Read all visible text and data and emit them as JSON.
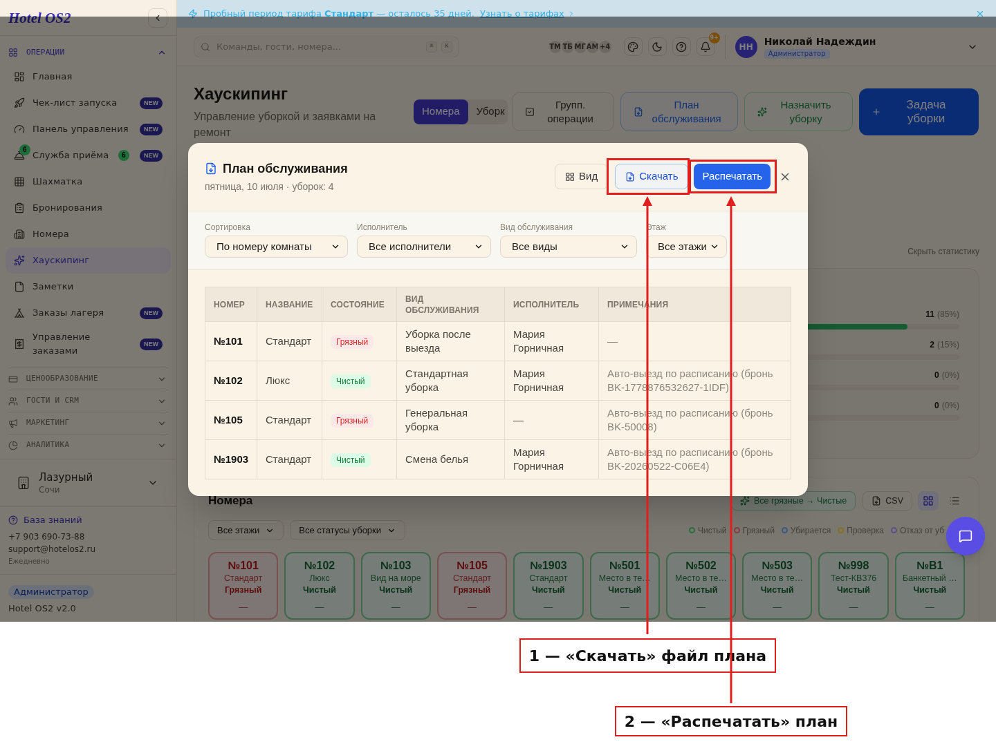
{
  "sidebar": {
    "logo": "Hotel OS2",
    "sections": [
      {
        "title": "ОПЕРАЦИИ",
        "expanded": true,
        "items": [
          {
            "label": "Главная",
            "selected": false
          },
          {
            "label": "Чек-лист запуска",
            "selected": false,
            "badge": "NEW"
          },
          {
            "label": "Панель управления",
            "selected": false,
            "badge": "NEW"
          },
          {
            "label": "Служба приёма",
            "selected": false,
            "icon_badge": "6",
            "count": "6",
            "badge": "NEW"
          },
          {
            "label": "Шахматка",
            "selected": false
          },
          {
            "label": "Бронирования",
            "selected": false
          },
          {
            "label": "Номера",
            "selected": false
          },
          {
            "label": "Хаускипинг",
            "selected": true
          },
          {
            "label": "Заметки",
            "selected": false
          },
          {
            "label": "Заказы лагеря",
            "selected": false,
            "badge": "NEW"
          },
          {
            "label": "Управление заказами",
            "selected": false,
            "badge": "NEW"
          }
        ]
      },
      {
        "title": "ЦЕНООБРАЗОВАНИЕ",
        "expanded": false
      },
      {
        "title": "ГОСТИ И CRM",
        "expanded": false
      },
      {
        "title": "МАРКЕТИНГ",
        "expanded": false
      },
      {
        "title": "АНАЛИТИКА",
        "expanded": false
      }
    ],
    "hotel": {
      "name": "Лазурный",
      "city": "Сочи"
    },
    "help_link": "База знаний",
    "phone": "+7 903 690-73-88",
    "email": "support@hotelos2.ru",
    "hours": "Ежедневно",
    "role": "Администратор",
    "version": "Hotel OS2 v2.0"
  },
  "banner": {
    "text": "Пробный период тарифа **Стандарт** — осталось 35 дней.",
    "link": "Узнать о тарифах"
  },
  "topbar": {
    "search": {
      "placeholder": "Команды, гости, номера...",
      "keys": [
        "⌘",
        "K"
      ]
    },
    "presence": [
      "ТМ",
      "ТБ",
      "МГ",
      "АМ"
    ],
    "presence_more": "+4",
    "notifications": "9+",
    "user": {
      "initials": "НН",
      "name": "Николай Надеждин",
      "role": "Администратор"
    }
  },
  "header": {
    "title": "Хаускипинг",
    "subtitle": "Управление уборкой и заявками на ремонт",
    "view_tabs": [
      {
        "label": "Номера",
        "selected": true
      },
      {
        "label": "Уборк",
        "selected": false
      }
    ],
    "actions": [
      {
        "label": "Групп. операции",
        "kind": "outline"
      },
      {
        "label": "План обслуживания",
        "kind": "blue"
      },
      {
        "label": "Назначить уборку",
        "kind": "green"
      },
      {
        "label": "Задача уборки",
        "kind": "primary"
      }
    ]
  },
  "stats": {
    "toggle": "Скрыть статистику",
    "rows": [
      {
        "count": "11",
        "percent": "(85%)",
        "level": 0.85
      },
      {
        "count": "2",
        "percent": "(15%)"
      },
      {
        "count": "0",
        "percent": "(0%)"
      },
      {
        "count": "0",
        "percent": "(0%)"
      }
    ]
  },
  "rooms": {
    "title": "Номера",
    "bulk_action": "Все грязные → Чистые",
    "export": "CSV",
    "views": [
      {
        "kind": "grid",
        "selected": true
      },
      {
        "kind": "list",
        "selected": false
      }
    ],
    "filters": [
      "Все этажи",
      "Все статусы уборки"
    ],
    "legend": [
      {
        "label": "Чистый",
        "color": "#2a7046"
      },
      {
        "label": "Грязный",
        "color": "#8a3d3d"
      },
      {
        "label": "Убирается",
        "color": "#3a5a86"
      },
      {
        "label": "Проверка",
        "color": "#86701a"
      },
      {
        "label": "Отказ от уб",
        "color": "#5c4e8c"
      }
    ],
    "cards": [
      {
        "number": "№101",
        "type": "Стандарт",
        "status": "Грязный",
        "kind": "dirty",
        "note": "—"
      },
      {
        "number": "№102",
        "type": "Люкс",
        "status": "Чистый",
        "kind": "clean",
        "note": "—"
      },
      {
        "number": "№103",
        "type": "Вид на море",
        "status": "Чистый",
        "kind": "clean",
        "note": "—"
      },
      {
        "number": "№105",
        "type": "Стандарт",
        "status": "Грязный",
        "kind": "dirty",
        "note": "—"
      },
      {
        "number": "№1903",
        "type": "Стандарт",
        "status": "Чистый",
        "kind": "clean",
        "note": "—"
      },
      {
        "number": "№501",
        "type": "Место в те…",
        "status": "Чистый",
        "kind": "clean",
        "note": "—"
      },
      {
        "number": "№502",
        "type": "Место в те…",
        "status": "Чистый",
        "kind": "clean",
        "note": "—"
      },
      {
        "number": "№503",
        "type": "Место в те…",
        "status": "Чистый",
        "kind": "clean",
        "note": "—"
      },
      {
        "number": "№998",
        "type": "Тест-КВ376",
        "status": "Чистый",
        "kind": "clean",
        "note": "—"
      },
      {
        "number": "№В1",
        "type": "Банкетный …",
        "status": "Чистый",
        "kind": "clean",
        "note": "—"
      }
    ]
  },
  "plan_modal": {
    "title": "План обслуживания",
    "subtitle": "пятница, 10 июля · уборок: 4",
    "actions": [
      {
        "label": "Вид",
        "kind": "view"
      },
      {
        "label": "Скачать",
        "kind": "download"
      },
      {
        "label": "Распечатать",
        "kind": "print"
      }
    ],
    "filters": [
      {
        "label": "Сортировка",
        "value": "По номеру комнаты"
      },
      {
        "label": "Исполнитель",
        "value": "Все исполнители"
      },
      {
        "label": "Вид обслуживания",
        "value": "Все виды"
      },
      {
        "label": "Этаж",
        "value": "Все этажи"
      }
    ],
    "table": {
      "columns": [
        "НОМЕР",
        "НАЗВАНИЕ",
        "СОСТОЯНИЕ",
        "ВИД ОБСЛУЖИВАНИЯ",
        "ИСПОЛНИТЕЛЬ",
        "ПРИМЕЧАНИЯ"
      ],
      "rows": [
        {
          "number": "№101",
          "name": "Стандарт",
          "status": {
            "label": "Грязный",
            "kind": "dirty"
          },
          "service": "Уборка после выезда",
          "assignee": "Мария Горничная",
          "notes": "—"
        },
        {
          "number": "№102",
          "name": "Люкс",
          "status": {
            "label": "Чистый",
            "kind": "clean"
          },
          "service": "Стандартная уборка",
          "assignee": "Мария Горничная",
          "notes": "Авто-выезд по расписанию (бронь BK-1778876532627-1IDF)"
        },
        {
          "number": "№105",
          "name": "Стандарт",
          "status": {
            "label": "Грязный",
            "kind": "dirty"
          },
          "service": "Генеральная уборка",
          "assignee": "—",
          "notes": "Авто-выезд по расписанию (бронь BK-50008)"
        },
        {
          "number": "№1903",
          "name": "Стандарт",
          "status": {
            "label": "Чистый",
            "kind": "clean"
          },
          "service": "Смена белья",
          "assignee": "Мария Горничная",
          "notes": "Авто-выезд по расписанию (бронь BK-20260522-C06E4)"
        }
      ]
    }
  },
  "annotations": [
    {
      "label": "1 — «Скачать» файл плана"
    },
    {
      "label": "2 — «Распечатать» план"
    }
  ]
}
